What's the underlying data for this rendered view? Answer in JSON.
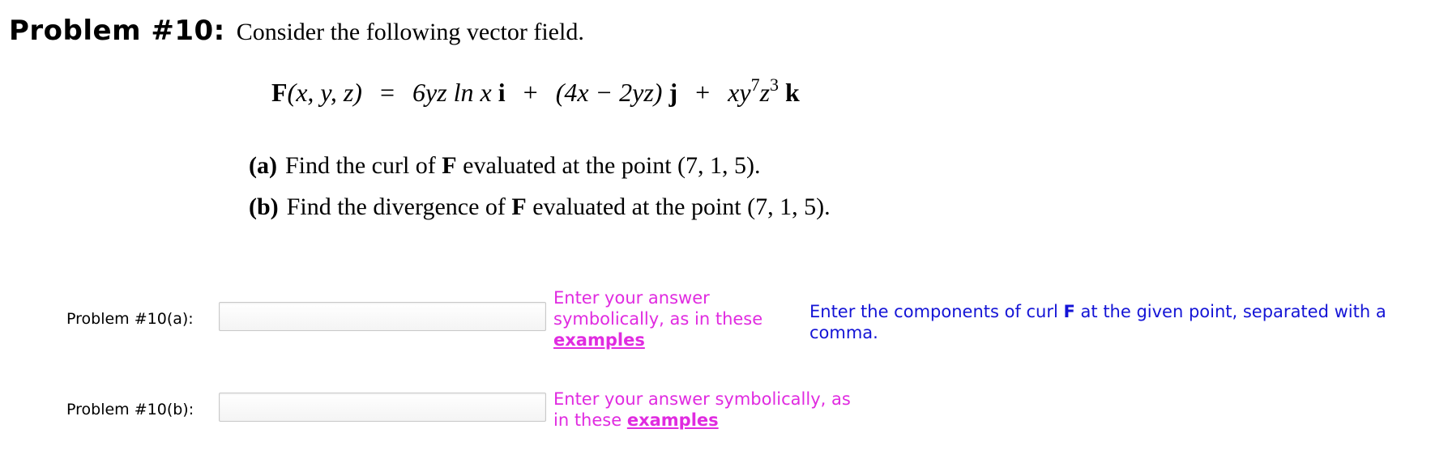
{
  "problem": {
    "number": "Problem #10:",
    "intro": "Consider the following vector field."
  },
  "equation": {
    "lhs_F": "F",
    "lhs_args": "(x, y, z)",
    "equals": "=",
    "term1": "6yz ln x",
    "i_vec": "i",
    "plus1": "+",
    "term2": "(4x − 2yz)",
    "j_vec": "j",
    "plus2": "+",
    "term3_base": "xy",
    "term3_exp1": "7",
    "term3_z": "z",
    "term3_exp2": "3",
    "k_vec": "k"
  },
  "parts": {
    "a": {
      "letter": "(a)",
      "pre": "Find the curl of ",
      "F": "F",
      "post": " evaluated at the point (7, 1, 5)."
    },
    "b": {
      "letter": "(b)",
      "pre": "Find the divergence of ",
      "F": "F",
      "post": " evaluated at the point (7, 1, 5)."
    }
  },
  "answers": {
    "a": {
      "label": "Problem #10(a):",
      "value": "",
      "hint_pre": "Enter your answer symbolically, as in these ",
      "hint_link": "examples",
      "note_pre": "Enter the components of curl ",
      "note_F": "F",
      "note_post": " at the given point, separated with a comma."
    },
    "b": {
      "label": "Problem #10(b):",
      "value": "",
      "hint_pre": "Enter your answer symbolically, as in these ",
      "hint_link": "examples"
    }
  },
  "colors": {
    "hint": "#e02be0",
    "note": "#1414d6"
  }
}
